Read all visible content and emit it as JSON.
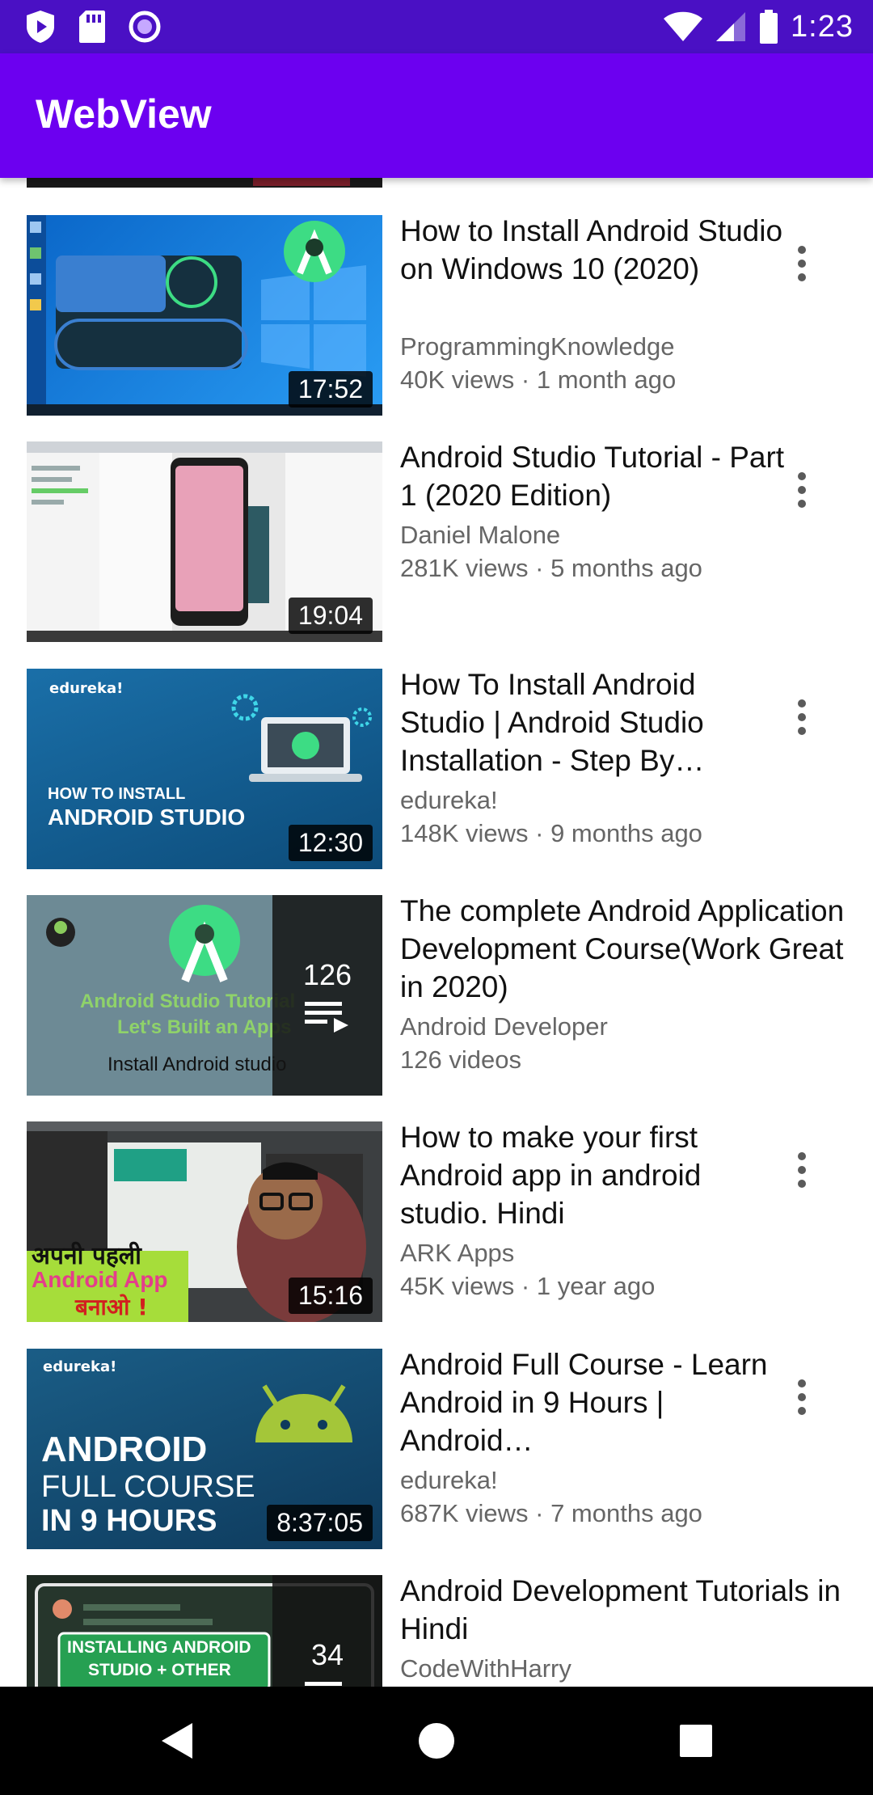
{
  "status_bar": {
    "time": "1:23"
  },
  "app_bar": {
    "title": "WebView"
  },
  "videos": [
    {
      "title": "How to Install Android Studio on Windows 10 (2020)",
      "channel": "ProgrammingKnowledge",
      "stats": "40K views · 1 month ago",
      "duration": "17:52"
    },
    {
      "title": "Android Studio Tutorial - Part 1 (2020 Edition)",
      "channel": "Daniel Malone",
      "stats": "281K views · 5 months ago",
      "duration": "19:04"
    },
    {
      "title": "How To Install Android Studio | Android Studio Installation - Step By…",
      "channel": "edureka!",
      "stats": "148K views · 9 months ago",
      "duration": "12:30",
      "thumb_brand": "edureka!",
      "thumb_line1": "HOW TO INSTALL",
      "thumb_line2": "ANDROID STUDIO"
    },
    {
      "title": "The complete Android Application Development Course(Work Great in 2020)",
      "channel": "Android Developer",
      "stats": "126 videos",
      "playlist_count": "126",
      "thumb_line1": "Android Studio Tutorial",
      "thumb_line2": "Let's Built an Apps",
      "thumb_line3": "Install Android studio"
    },
    {
      "title": "How to make your first Android app in android studio. Hindi",
      "channel": "ARK Apps",
      "stats": "45K views · 1 year ago",
      "duration": "15:16",
      "thumb_line1": "अपनी पहली",
      "thumb_line2": "Android App",
      "thumb_line3": "बनाओ !"
    },
    {
      "title": "Android Full Course - Learn Android in 9 Hours | Android…",
      "channel": "edureka!",
      "stats": "687K views · 7 months ago",
      "duration": "8:37:05",
      "thumb_brand": "edureka!",
      "thumb_line1": "ANDROID",
      "thumb_line2": "FULL COURSE",
      "thumb_line3": "IN 9 HOURS"
    },
    {
      "title": "Android Development Tutorials in Hindi",
      "channel": "CodeWithHarry",
      "playlist_count": "34",
      "thumb_line1": "INSTALLING ANDROID",
      "thumb_line2": "STUDIO + OTHER"
    }
  ],
  "colors": {
    "status_bar": "#4a10c4",
    "app_bar": "#6c00f0",
    "nav_bar": "#000000"
  },
  "icons": {
    "status_left": [
      "shield-icon",
      "sd-card-icon",
      "record-icon"
    ],
    "status_right": [
      "wifi-icon",
      "signal-icon",
      "battery-icon"
    ],
    "nav": [
      "back-icon",
      "home-icon",
      "recents-icon"
    ]
  }
}
